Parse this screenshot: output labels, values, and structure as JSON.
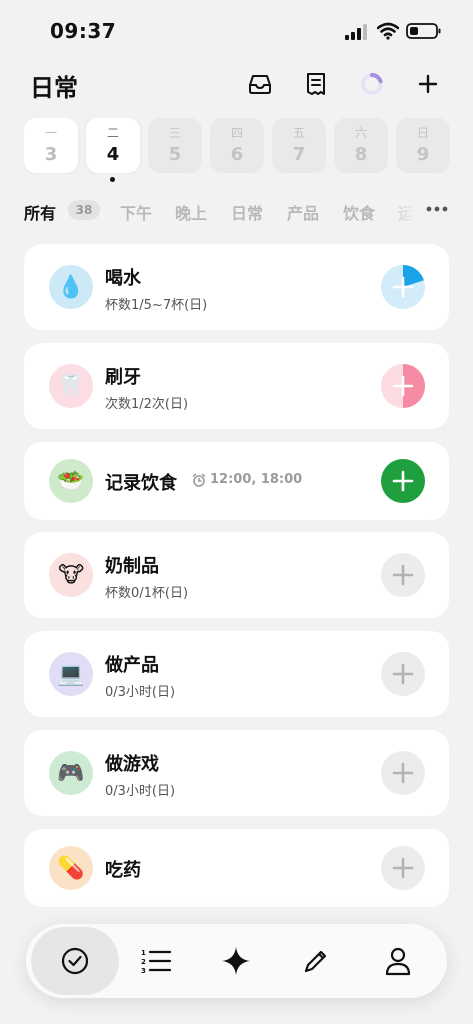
{
  "status_bar": {
    "time": "09:37"
  },
  "header": {
    "title": "日常",
    "progress_ring_fraction": 0.2
  },
  "dates": [
    {
      "weekday": "一",
      "day": "3",
      "state": "today"
    },
    {
      "weekday": "二",
      "day": "4",
      "state": "selected"
    },
    {
      "weekday": "三",
      "day": "5",
      "state": "future"
    },
    {
      "weekday": "四",
      "day": "6",
      "state": "future"
    },
    {
      "weekday": "五",
      "day": "7",
      "state": "future"
    },
    {
      "weekday": "六",
      "day": "8",
      "state": "future"
    },
    {
      "weekday": "日",
      "day": "9",
      "state": "future"
    }
  ],
  "filters": {
    "active": "所有",
    "count": "38",
    "tabs": [
      "下午",
      "晚上",
      "日常",
      "产品",
      "饮食",
      "运"
    ]
  },
  "tasks": [
    {
      "name": "喝水",
      "sub": "杯数1/5~7杯(日)",
      "emoji": "💧",
      "icon_bg": "#cde9f8",
      "progress": 0.2,
      "color": "#1aa3e8",
      "light": "#d3ecfa"
    },
    {
      "name": "刷牙",
      "sub": "次数1/2次(日)",
      "emoji": "🦷",
      "icon_bg": "#fbdde3",
      "progress": 0.5,
      "color": "#f58aa3",
      "light": "#fddbe3"
    },
    {
      "name": "记录饮食",
      "reminder": "12:00, 18:00",
      "emoji": "🥗",
      "icon_bg": "#cfeacb",
      "button": "green",
      "color": "#1f9f3d"
    },
    {
      "name": "奶制品",
      "sub": "杯数0/1杯(日)",
      "emoji": "🐮",
      "icon_bg": "#fbe0e0",
      "progress": 0
    },
    {
      "name": "做产品",
      "sub": "0/3小时(日)",
      "emoji": "💻",
      "icon_bg": "#e2dcf7",
      "progress": 0
    },
    {
      "name": "做游戏",
      "sub": "0/3小时(日)",
      "emoji": "🎮",
      "icon_bg": "#cdebd3",
      "progress": 0
    },
    {
      "name": "吃药",
      "emoji": "💊",
      "icon_bg": "#fbe2c6",
      "progress": 0
    }
  ],
  "bottom_nav": {
    "items": [
      "check-circle-icon",
      "numbered-list-icon",
      "sparkle-icon",
      "pencil-icon",
      "person-icon"
    ],
    "active": "check-circle-icon"
  }
}
